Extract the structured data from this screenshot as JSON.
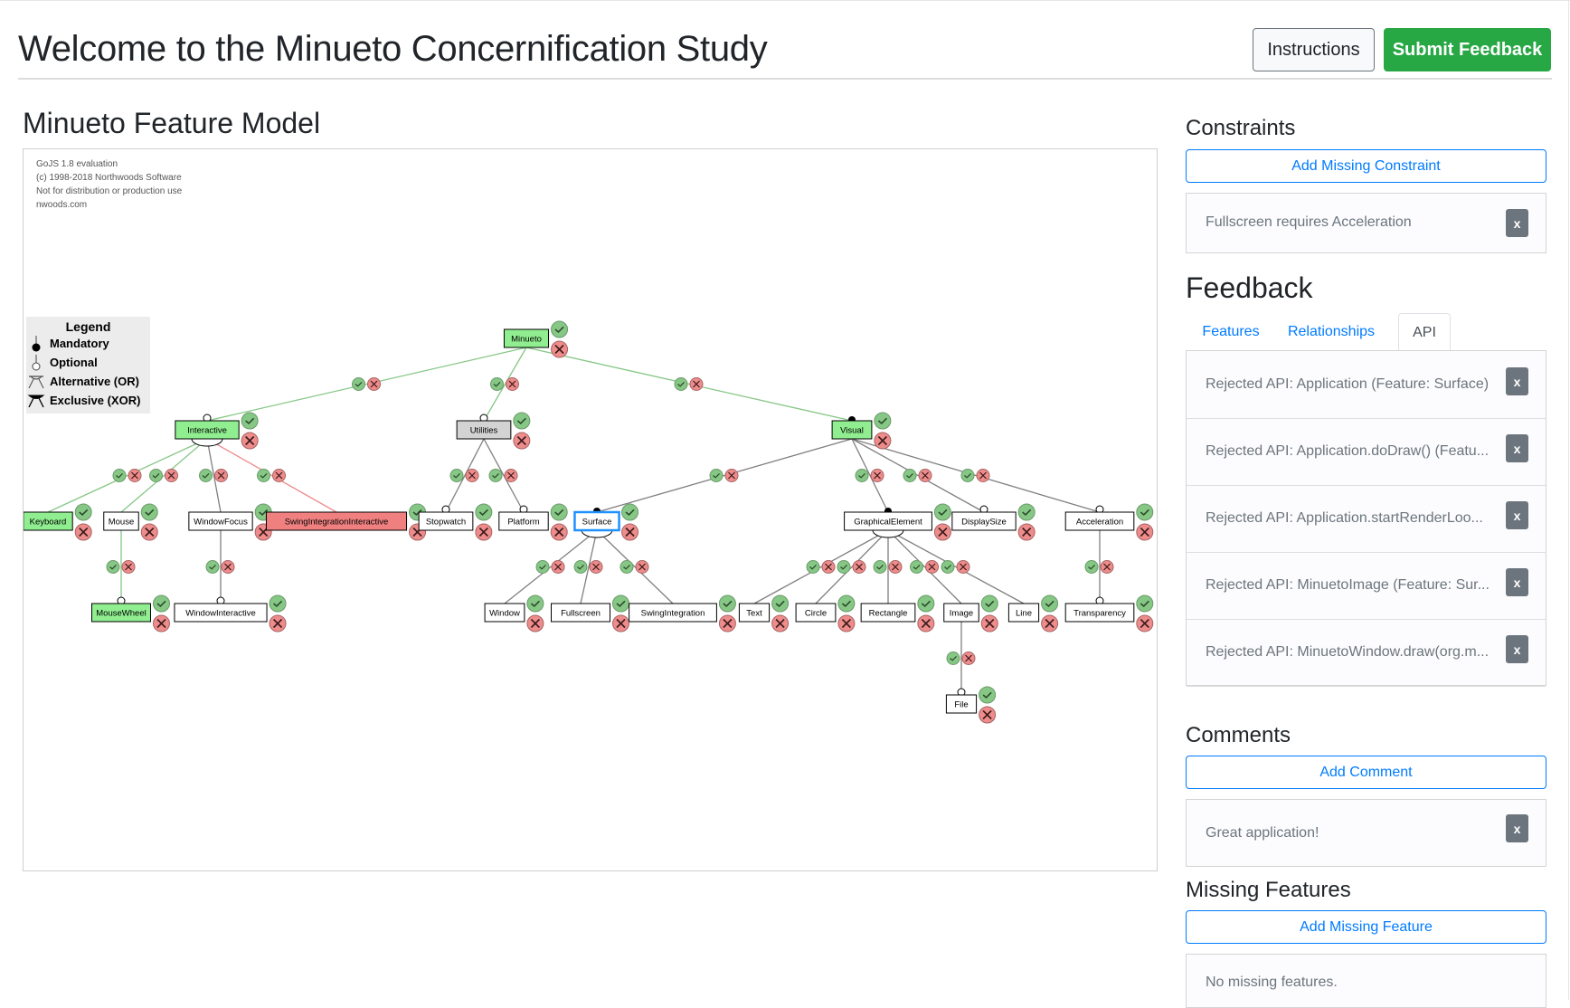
{
  "header": {
    "title": "Welcome to the Minueto Concernification Study",
    "instructions_label": "Instructions",
    "submit_label": "Submit Feedback"
  },
  "colors": {
    "accept": "#86c786",
    "reject": "#ee8c8c",
    "node_accepted": "#90ee90",
    "node_rejected": "#f08080",
    "node_neutral": "#d3d3d3",
    "node_default": "#ffffff",
    "selected_border": "#1e90ff",
    "primary": "#007bff",
    "success": "#28a745",
    "secondary": "#6c757d"
  },
  "model": {
    "heading": "Minueto Feature Model",
    "watermark": [
      "GoJS 1.8 evaluation",
      "(c) 1998-2018 Northwoods Software",
      "Not for distribution or production use",
      "nwoods.com"
    ],
    "legend": {
      "title": "Legend",
      "items": [
        {
          "icon": "mandatory-icon",
          "label": "Mandatory"
        },
        {
          "icon": "optional-icon",
          "label": "Optional"
        },
        {
          "icon": "alternative-or-icon",
          "label": "Alternative (OR)"
        },
        {
          "icon": "exclusive-xor-icon",
          "label": "Exclusive (XOR)"
        }
      ]
    },
    "nodes": [
      {
        "id": "Minueto",
        "state": "accepted"
      },
      {
        "id": "Interactive",
        "state": "accepted",
        "group": "or"
      },
      {
        "id": "Utilities",
        "state": "neutral"
      },
      {
        "id": "Visual",
        "state": "accepted"
      },
      {
        "id": "Keyboard",
        "state": "accepted"
      },
      {
        "id": "Mouse",
        "state": "default"
      },
      {
        "id": "WindowFocus",
        "state": "default"
      },
      {
        "id": "SwingIntegrationInteractive",
        "state": "rejected"
      },
      {
        "id": "Stopwatch",
        "state": "default"
      },
      {
        "id": "Platform",
        "state": "default"
      },
      {
        "id": "Surface",
        "state": "default",
        "selected": true,
        "group": "or"
      },
      {
        "id": "GraphicalElement",
        "state": "default",
        "group": "or"
      },
      {
        "id": "DisplaySize",
        "state": "default"
      },
      {
        "id": "Acceleration",
        "state": "default"
      },
      {
        "id": "MouseWheel",
        "state": "accepted"
      },
      {
        "id": "WindowInteractive",
        "state": "default"
      },
      {
        "id": "Window",
        "state": "default"
      },
      {
        "id": "Fullscreen",
        "state": "default"
      },
      {
        "id": "SwingIntegration",
        "state": "default"
      },
      {
        "id": "Text",
        "state": "default"
      },
      {
        "id": "Circle",
        "state": "default"
      },
      {
        "id": "Rectangle",
        "state": "default"
      },
      {
        "id": "Image",
        "state": "default"
      },
      {
        "id": "Line",
        "state": "default"
      },
      {
        "id": "Transparency",
        "state": "default"
      },
      {
        "id": "File",
        "state": "default"
      }
    ],
    "edges": [
      {
        "from": "Minueto",
        "to": "Interactive",
        "kind": "optional",
        "state": "accepted"
      },
      {
        "from": "Minueto",
        "to": "Utilities",
        "kind": "optional",
        "state": "accepted"
      },
      {
        "from": "Minueto",
        "to": "Visual",
        "kind": "mandatory",
        "state": "accepted"
      },
      {
        "from": "Interactive",
        "to": "Keyboard",
        "kind": "or",
        "state": "accepted"
      },
      {
        "from": "Interactive",
        "to": "Mouse",
        "kind": "or",
        "state": "accepted"
      },
      {
        "from": "Interactive",
        "to": "WindowFocus",
        "kind": "or",
        "state": "default"
      },
      {
        "from": "Interactive",
        "to": "SwingIntegrationInteractive",
        "kind": "or",
        "state": "rejected"
      },
      {
        "from": "Utilities",
        "to": "Stopwatch",
        "kind": "optional",
        "state": "default"
      },
      {
        "from": "Utilities",
        "to": "Platform",
        "kind": "optional",
        "state": "default"
      },
      {
        "from": "Visual",
        "to": "Surface",
        "kind": "mandatory",
        "state": "default"
      },
      {
        "from": "Visual",
        "to": "GraphicalElement",
        "kind": "mandatory",
        "state": "default"
      },
      {
        "from": "Visual",
        "to": "DisplaySize",
        "kind": "optional",
        "state": "default"
      },
      {
        "from": "Visual",
        "to": "Acceleration",
        "kind": "optional",
        "state": "default"
      },
      {
        "from": "Mouse",
        "to": "MouseWheel",
        "kind": "optional",
        "state": "accepted"
      },
      {
        "from": "WindowFocus",
        "to": "WindowInteractive",
        "kind": "optional",
        "state": "default"
      },
      {
        "from": "Surface",
        "to": "Window",
        "kind": "or",
        "state": "default"
      },
      {
        "from": "Surface",
        "to": "Fullscreen",
        "kind": "or",
        "state": "default"
      },
      {
        "from": "Surface",
        "to": "SwingIntegration",
        "kind": "or",
        "state": "default"
      },
      {
        "from": "GraphicalElement",
        "to": "Text",
        "kind": "or",
        "state": "default"
      },
      {
        "from": "GraphicalElement",
        "to": "Circle",
        "kind": "or",
        "state": "default"
      },
      {
        "from": "GraphicalElement",
        "to": "Rectangle",
        "kind": "or",
        "state": "default"
      },
      {
        "from": "GraphicalElement",
        "to": "Image",
        "kind": "or",
        "state": "default"
      },
      {
        "from": "GraphicalElement",
        "to": "Line",
        "kind": "or",
        "state": "default"
      },
      {
        "from": "Acceleration",
        "to": "Transparency",
        "kind": "optional",
        "state": "default"
      },
      {
        "from": "Image",
        "to": "File",
        "kind": "optional",
        "state": "default"
      }
    ]
  },
  "constraints": {
    "heading": "Constraints",
    "add_label": "Add Missing Constraint",
    "items": [
      {
        "text": "Fullscreen requires Acceleration",
        "remove_label": "x"
      }
    ]
  },
  "feedback": {
    "heading": "Feedback",
    "tabs": [
      {
        "label": "Features",
        "active": false
      },
      {
        "label": "Relationships",
        "active": false
      },
      {
        "label": "API",
        "active": true
      }
    ],
    "api_items": [
      {
        "text": "Rejected API: Application (Feature: Surface)",
        "remove_label": "x"
      },
      {
        "text": "Rejected API: Application.doDraw() (Featu...",
        "remove_label": "x"
      },
      {
        "text": "Rejected API: Application.startRenderLoo...",
        "remove_label": "x"
      },
      {
        "text": "Rejected API: MinuetoImage (Feature: Sur...",
        "remove_label": "x"
      },
      {
        "text": "Rejected API: MinuetoWindow.draw(org.m...",
        "remove_label": "x"
      }
    ]
  },
  "comments": {
    "heading": "Comments",
    "add_label": "Add Comment",
    "items": [
      {
        "text": "Great application!",
        "remove_label": "x"
      }
    ]
  },
  "missing_features": {
    "heading": "Missing Features",
    "add_label": "Add Missing Feature",
    "empty_text": "No missing features."
  }
}
